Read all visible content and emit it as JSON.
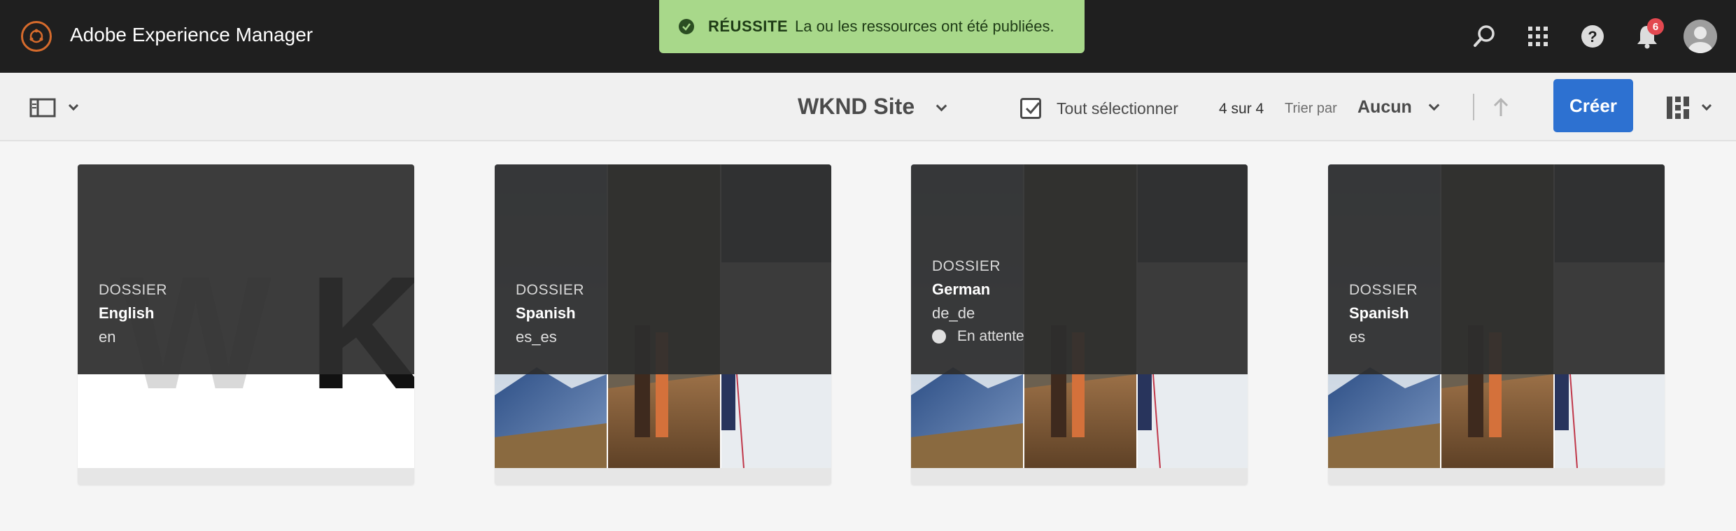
{
  "app": {
    "title": "Adobe Experience Manager",
    "notification_count": "6"
  },
  "toast": {
    "label": "RÉUSSITE",
    "message": "La ou les ressources ont été publiées."
  },
  "toolbar": {
    "site_title": "WKND Site",
    "select_all_label": "Tout sélectionner",
    "count": "4 sur 4",
    "sort_label": "Trier par",
    "sort_value": "Aucun",
    "create_label": "Créer"
  },
  "cards": [
    {
      "type": "DOSSIER",
      "name": "English",
      "lang": "en"
    },
    {
      "type": "DOSSIER",
      "name": "Spanish",
      "lang": "es_es"
    },
    {
      "type": "DOSSIER",
      "name": "German",
      "lang": "de_de",
      "status": "En attente"
    },
    {
      "type": "DOSSIER",
      "name": "Spanish",
      "lang": "es"
    }
  ],
  "colors": {
    "topbar": "#1f1f1f",
    "accent": "#2d71d1",
    "toast": "#a8d88a",
    "badge": "#e34850"
  }
}
